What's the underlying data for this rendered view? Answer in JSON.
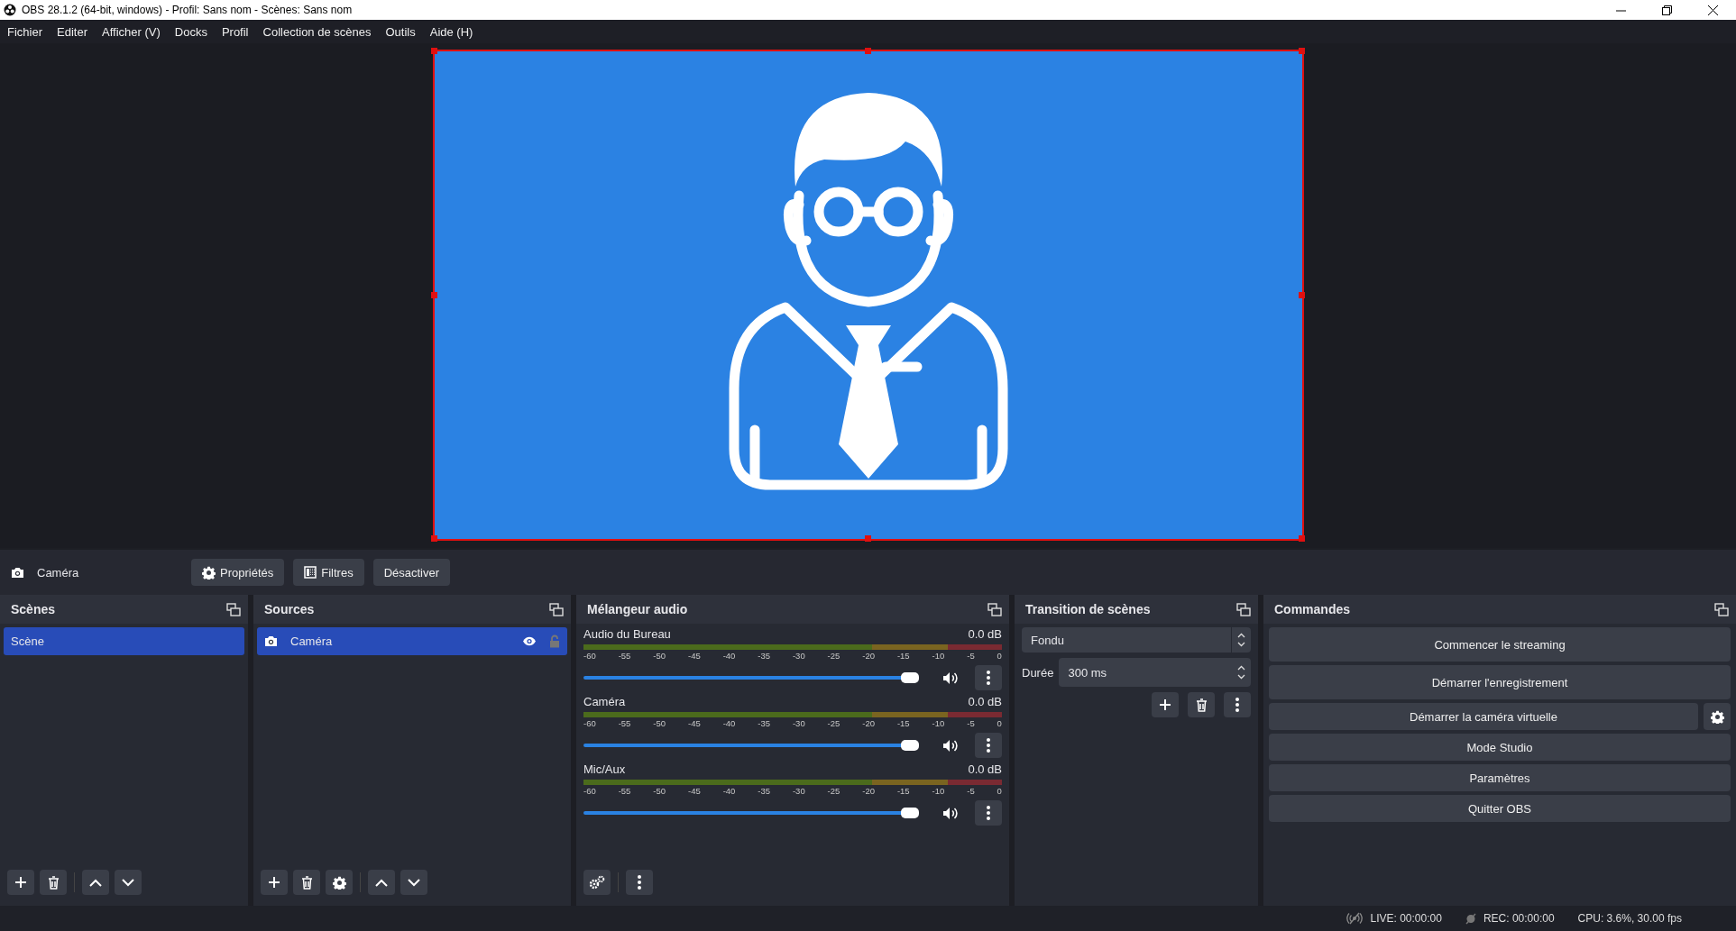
{
  "window": {
    "title": "OBS 28.1.2 (64-bit, windows) - Profil: Sans nom - Scènes: Sans nom"
  },
  "menu": [
    "Fichier",
    "Editer",
    "Afficher (V)",
    "Docks",
    "Profil",
    "Collection de scènes",
    "Outils",
    "Aide (H)"
  ],
  "preview": {
    "source_selected": true
  },
  "source_toolbar": {
    "source": "Caméra",
    "buttons": [
      {
        "kind": "properties",
        "label": "Propriétés"
      },
      {
        "kind": "filters",
        "label": "Filtres"
      },
      {
        "kind": "plain",
        "label": "Désactiver"
      }
    ]
  },
  "scenes": {
    "title": "Scènes",
    "items": [
      {
        "label": "Scène",
        "selected": true
      }
    ]
  },
  "sources": {
    "title": "Sources",
    "items": [
      {
        "label": "Caméra",
        "selected": true,
        "visible": true,
        "locked": false
      }
    ]
  },
  "mixer": {
    "title": "Mélangeur audio",
    "channels": [
      {
        "name": "Audio du Bureau",
        "reading": "0.0 dB",
        "level": 0.96,
        "scale": [
          "-60",
          "-55",
          "-50",
          "-45",
          "-40",
          "-35",
          "-30",
          "-25",
          "-20",
          "-15",
          "-10",
          "-5",
          "0"
        ]
      },
      {
        "name": "Caméra",
        "reading": "0.0 dB",
        "level": 0.96,
        "scale": [
          "-60",
          "-55",
          "-50",
          "-45",
          "-40",
          "-35",
          "-30",
          "-25",
          "-20",
          "-15",
          "-10",
          "-5",
          "0"
        ]
      },
      {
        "name": "Mic/Aux",
        "reading": "0.0 dB",
        "level": 0.96,
        "scale": [
          "-60",
          "-55",
          "-50",
          "-45",
          "-40",
          "-35",
          "-30",
          "-25",
          "-20",
          "-15",
          "-10",
          "-5",
          "0"
        ]
      }
    ]
  },
  "transition": {
    "title": "Transition de scènes",
    "type": "Fondu",
    "duration_label": "Durée",
    "duration": "300 ms"
  },
  "controls": {
    "title": "Commandes",
    "buttons": [
      {
        "kind": "plain",
        "label": "Commencer le streaming"
      },
      {
        "kind": "plain",
        "label": "Démarrer l'enregistrement"
      },
      {
        "kind": "with-settings",
        "label": "Démarrer la caméra virtuelle"
      },
      {
        "kind": "plain",
        "label": "Mode Studio"
      },
      {
        "kind": "plain",
        "label": "Paramètres"
      },
      {
        "kind": "plain",
        "label": "Quitter OBS"
      }
    ]
  },
  "status_bar": {
    "live": "LIVE: 00:00:00",
    "rec": "REC: 00:00:00",
    "cpu": "CPU: 3.6%, 30.00 fps"
  }
}
